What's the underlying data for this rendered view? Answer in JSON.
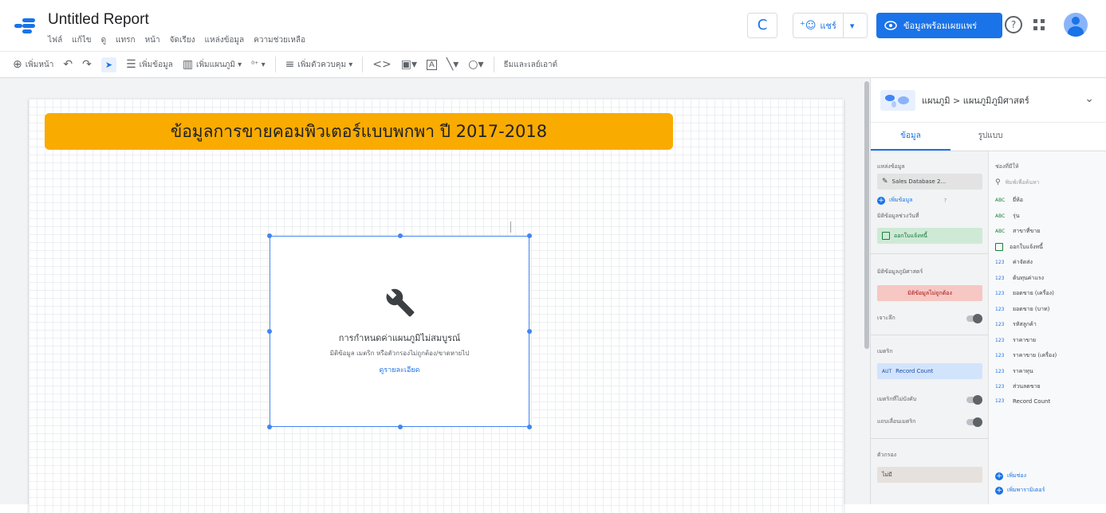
{
  "header": {
    "title": "Untitled Report",
    "menu": [
      "ไฟล์",
      "แก้ไข",
      "ดู",
      "แทรก",
      "หน้า",
      "จัดเรียง",
      "แหล่งข้อมูล",
      "ความช่วยเหลือ"
    ],
    "refresh_icon": "C",
    "share_label": "แชร์",
    "share_caret": "▾",
    "view_label": "ข้อมูลพร้อมเผยแพร่",
    "help_icon": "?"
  },
  "toolbar": {
    "add_page": "เพิ่มหน้า",
    "undo_icon": "↶",
    "redo_icon": "↷",
    "select_icon": "➤",
    "add_data": "เพิ่มข้อมูล",
    "add_chart": "เพิ่มแผนภูมิ ▾",
    "community": "⁰⁺ ▾",
    "add_control": "เพิ่มตัวควบคุม ▾",
    "embed_icon": "<>",
    "image_icon": "▣▾",
    "text_icon": "A",
    "line_icon": "╲▾",
    "shape_icon": "○▾",
    "theme": "ธีมและเลย์เอาต์"
  },
  "canvas": {
    "banner_title": "ข้อมูลการขายคอมพิวเตอร์แบบพกพา ปี 2017-2018",
    "chart_config_title": "การกำหนดค่าแผนภูมิไม่สมบูรณ์",
    "chart_config_text": "มิติข้อมูล เมตริก หรือตัวกรองไม่ถูกต้อง/ขาดหายไป",
    "chart_config_link": "ดูรายละเอียด"
  },
  "panel": {
    "breadcrumb": "แผนภูมิ > แผนภูมิภูมิศาสตร์",
    "chevron": "⌄",
    "tabs": [
      "ข้อมูล",
      "รูปแบบ"
    ],
    "left": {
      "datasource_label": "แหล่งข้อมูล",
      "datasource_value": "Sales Database 2...",
      "add_data_label": "เพิ่มข้อมูล",
      "date_dim_label": "มิติข้อมูลช่วงวันที่",
      "date_dim_value": "ออกใบแจ้งหนี้",
      "geo_dim_label": "มิติข้อมูลภูมิศาสตร์",
      "geo_dim_value": "มิติข้อมูลไม่ถูกต้อง",
      "drill_label": "เจาะลึก",
      "metric_label": "เมตริก",
      "metric_tag": "AUT",
      "metric_value": "Record Count",
      "optional_metric_label": "เมตริกที่ไม่บังคับ",
      "metric_slider_label": "แถบเลื่อนเมตริก",
      "filter_label": "ตัวกรอง",
      "filter_value": "ไม่มี"
    },
    "right": {
      "available_label": "ช่องที่มีให้",
      "search_placeholder": "พิมพ์เพื่อค้นหา",
      "fields": [
        {
          "type": "ABC",
          "name": "ยี่ห้อ"
        },
        {
          "type": "ABC",
          "name": "รุ่น"
        },
        {
          "type": "ABC",
          "name": "สาขาที่ขาย"
        },
        {
          "type": "date",
          "name": "ออกใบแจ้งหนี้"
        },
        {
          "type": "123",
          "name": "ค่าจัดส่ง"
        },
        {
          "type": "123",
          "name": "ต้นทุนค่าแรง"
        },
        {
          "type": "123",
          "name": "ยอดขาย (เครื่อง)"
        },
        {
          "type": "123",
          "name": "ยอดขาย (บาท)"
        },
        {
          "type": "123",
          "name": "รหัสลูกค้า"
        },
        {
          "type": "123",
          "name": "ราคาขาย"
        },
        {
          "type": "123",
          "name": "ราคาขาย (เครื่อง)"
        },
        {
          "type": "123",
          "name": "ราคาทุน"
        },
        {
          "type": "123",
          "name": "ส่วนลดขาย"
        },
        {
          "type": "123",
          "name": "Record Count"
        }
      ],
      "add_field": "เพิ่มช่อง",
      "add_parameter": "เพิ่มพารามิเตอร์"
    }
  }
}
